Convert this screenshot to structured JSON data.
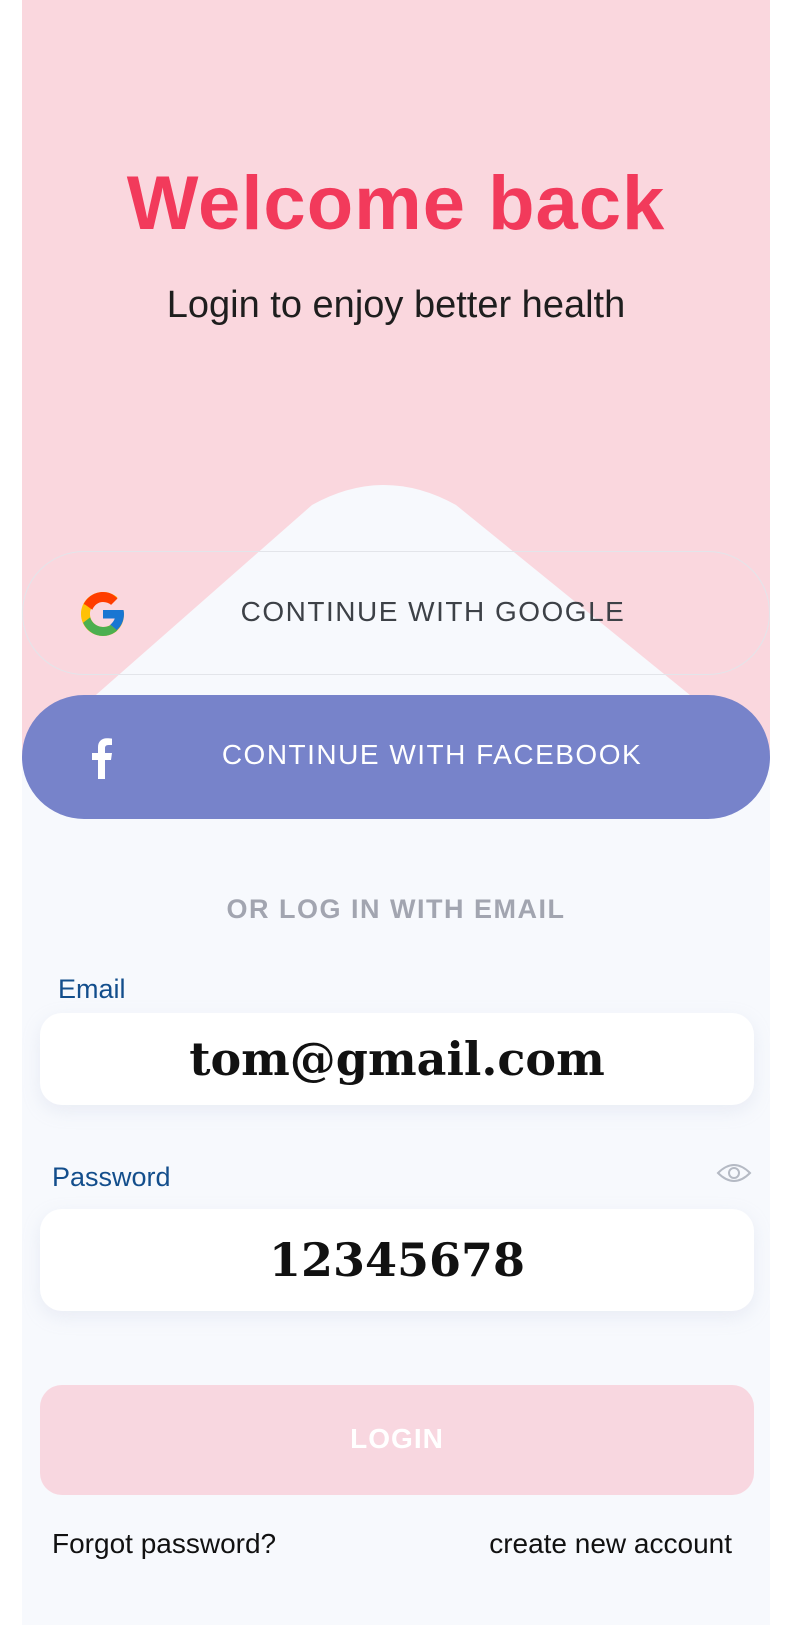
{
  "header": {
    "title": "Welcome back",
    "subtitle": "Login to enjoy better health"
  },
  "social": {
    "google_label": "CONTINUE WITH GOOGLE",
    "google_icon": "google-g-icon",
    "facebook_label": "CONTINUE WITH FACEBOOK",
    "facebook_icon": "facebook-f-icon"
  },
  "divider_label": "OR LOG IN WITH EMAIL",
  "form": {
    "email_label": "Email",
    "email_value": "tom@gmail.com",
    "password_label": "Password",
    "password_value": "12345678",
    "password_toggle_icon": "eye-icon",
    "login_label": "LOGIN"
  },
  "links": {
    "forgot": "Forgot password?",
    "create": "create new account"
  },
  "colors": {
    "accent": "#f23a5b",
    "pink_background": "#fad7de",
    "facebook_blue": "#7783ca",
    "label_blue": "#134e8c",
    "login_disabled": "#f8d7e0"
  }
}
